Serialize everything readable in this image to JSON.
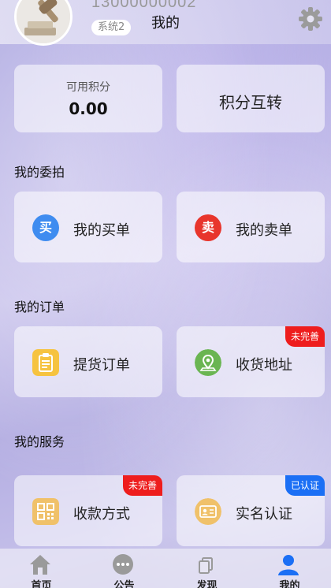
{
  "header": {
    "phone": "13000000002",
    "system_badge": "系统2",
    "title": "我的",
    "settings_icon": "gear-icon"
  },
  "points": {
    "label": "可用积分",
    "value": "0.00",
    "transfer_label": "积分互转"
  },
  "sections": {
    "commission": {
      "title": "我的委拍",
      "buy": {
        "icon_text": "买",
        "label": "我的买单",
        "color": "#3f8cf0"
      },
      "sell": {
        "icon_text": "卖",
        "label": "我的卖单",
        "color": "#e8352c"
      }
    },
    "orders": {
      "title": "我的订单",
      "pickup": {
        "label": "提货订单",
        "icon": "clipboard-icon",
        "color": "#f6c340"
      },
      "address": {
        "label": "收货地址",
        "icon": "location-pin-icon",
        "color": "#6ab552",
        "badge": "未完善",
        "badge_color": "#ee1d1d"
      }
    },
    "services": {
      "title": "我的服务",
      "payment": {
        "label": "收款方式",
        "icon": "qr-code-icon",
        "color": "#f0c16a",
        "badge": "未完善",
        "badge_color": "#ee1d1d"
      },
      "realname": {
        "label": "实名认证",
        "icon": "id-card-icon",
        "color": "#f0c16a",
        "badge": "已认证",
        "badge_color": "#1b6ff5"
      }
    }
  },
  "tabbar": {
    "items": [
      {
        "label": "首页",
        "icon": "home-icon"
      },
      {
        "label": "公告",
        "icon": "chat-bubble-icon"
      },
      {
        "label": "发现",
        "icon": "copy-pages-icon"
      },
      {
        "label": "我的",
        "icon": "user-icon",
        "active_color": "#1b6ff5"
      }
    ]
  }
}
